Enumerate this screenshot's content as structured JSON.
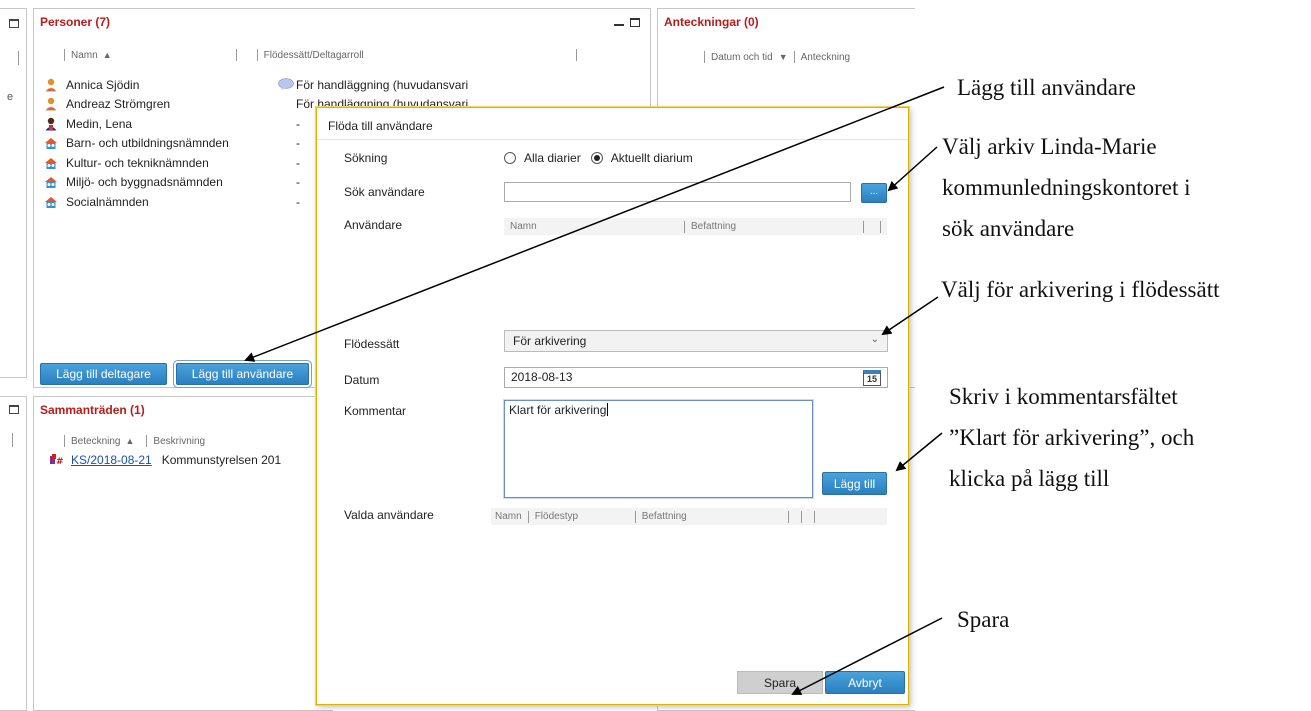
{
  "persons_panel": {
    "title": "Personer (7)",
    "columns": [
      "Namn",
      "Flödessätt/Deltagarroll"
    ],
    "sort_indicator": "▲",
    "rows": [
      {
        "icon": "person-icon",
        "name": "Annica Sjödin",
        "role": "För handläggning (huvudansvari",
        "has_comment": true
      },
      {
        "icon": "person-icon",
        "name": "Andreaz Strömgren",
        "role": "För handläggning (huvudansvari",
        "has_comment": false
      },
      {
        "icon": "person-dark-icon",
        "name": "Medin, Lena",
        "role": "-",
        "has_comment": false
      },
      {
        "icon": "group-icon",
        "name": "Barn- och utbildningsnämnden",
        "role": "-",
        "has_comment": false
      },
      {
        "icon": "group-icon",
        "name": "Kultur- och tekniknämnden",
        "role": "-",
        "has_comment": false
      },
      {
        "icon": "group-icon",
        "name": "Miljö- och byggnadsnämnden",
        "role": "-",
        "has_comment": false
      },
      {
        "icon": "group-icon",
        "name": "Socialnämnden",
        "role": "-",
        "has_comment": false
      }
    ],
    "buttons": {
      "add_participant": "Lägg till deltagare",
      "add_user": "Lägg till användare"
    }
  },
  "notes_panel": {
    "title": "Anteckningar (0)",
    "columns": [
      "Datum och tid",
      "Anteckning"
    ],
    "sort_indicator": "▼"
  },
  "meetings_panel": {
    "title": "Sammanträden (1)",
    "columns": [
      "Beteckning",
      "Beskrivning"
    ],
    "sort_indicator": "▲",
    "rows": [
      {
        "id": "KS/2018-08-21",
        "description": "Kommunstyrelsen 201"
      }
    ]
  },
  "dialog": {
    "title": "Flöda till användare",
    "search_label": "Sökning",
    "radio_all": "Alla diarier",
    "radio_current": "Aktuellt diarium",
    "selected_radio": "Aktuellt diarium",
    "search_user_label": "Sök användare",
    "search_user_value": "",
    "ellipsis": "...",
    "users_label": "Användare",
    "users_columns": [
      "Namn",
      "Befattning"
    ],
    "flow_label": "Flödessätt",
    "flow_value": "För arkivering",
    "date_label": "Datum",
    "date_value": "2018-08-13",
    "calendar_day": "15",
    "comment_label": "Kommentar",
    "comment_value": "Klart för arkivering",
    "add_button": "Lägg till",
    "selected_users_label": "Valda användare",
    "selected_columns": [
      "Namn",
      "Flödestyp",
      "Befattning"
    ],
    "save_button": "Spara",
    "cancel_button": "Avbryt"
  },
  "annotations": {
    "add_user": "Lägg till användare",
    "choose_archive_line1": "Välj arkiv Linda-Marie",
    "choose_archive_line2": "kommunledningskontoret i",
    "choose_archive_line3": "sök användare",
    "choose_flow": "Välj för arkivering i flödessätt",
    "comment_line1": "Skriv i kommentarsfältet",
    "comment_line2": "”Klart för arkivering”, och",
    "comment_line3": "klicka på lägg till",
    "save": "Spara"
  },
  "colors": {
    "panel_title": "#b71c1c",
    "button_blue": "#2b7fc0",
    "dialog_border": "#e0b300"
  }
}
